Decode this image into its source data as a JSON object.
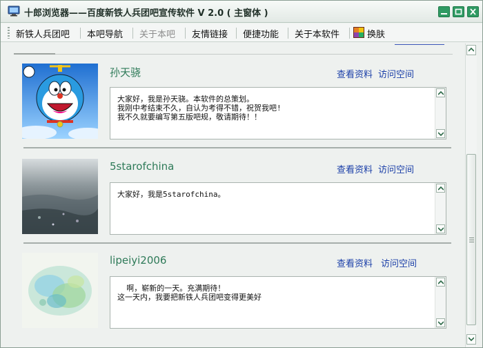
{
  "window": {
    "title": "十郎浏览器——百度新铁人兵团吧宣传软件 V 2.0 ( 主窗体 )"
  },
  "menu": {
    "items": [
      {
        "label": "新铁人兵团吧",
        "enabled": true
      },
      {
        "label": "本吧导航",
        "enabled": true
      },
      {
        "label": "关于本吧",
        "enabled": false
      },
      {
        "label": "友情链接",
        "enabled": true
      },
      {
        "label": "便捷功能",
        "enabled": true
      },
      {
        "label": "关于本软件",
        "enabled": true
      }
    ],
    "skin_label": "换肤"
  },
  "cards": [
    {
      "name": "孙天骁",
      "avatar_icon": "doraemon-avatar",
      "profile_link": "查看资料",
      "space_link": "访问空间",
      "message": "大家好，我是孙天骁。本软件的总策划。\n我刚中考结束不久，自认为考得不错，祝贺我吧!\n我不久就要编写第五版吧规，敬请期待！！"
    },
    {
      "name": "5starofchina",
      "avatar_icon": "city-aerial-avatar",
      "profile_link": "查看资料",
      "space_link": "访问空间",
      "message": "大家好，我是5starofchina。"
    },
    {
      "name": "lipeiyi2006",
      "avatar_icon": "watercolor-avatar",
      "profile_link": "查看资料",
      "space_link": "访问空间",
      "message": "  啊，崭新的一天。充满期待！\n这一天内，我要把新铁人兵团吧变得更美好"
    }
  ],
  "colors": {
    "title_button": "#2f9a63",
    "name_color": "#2e7a58",
    "link_color": "#1b3fa8"
  }
}
